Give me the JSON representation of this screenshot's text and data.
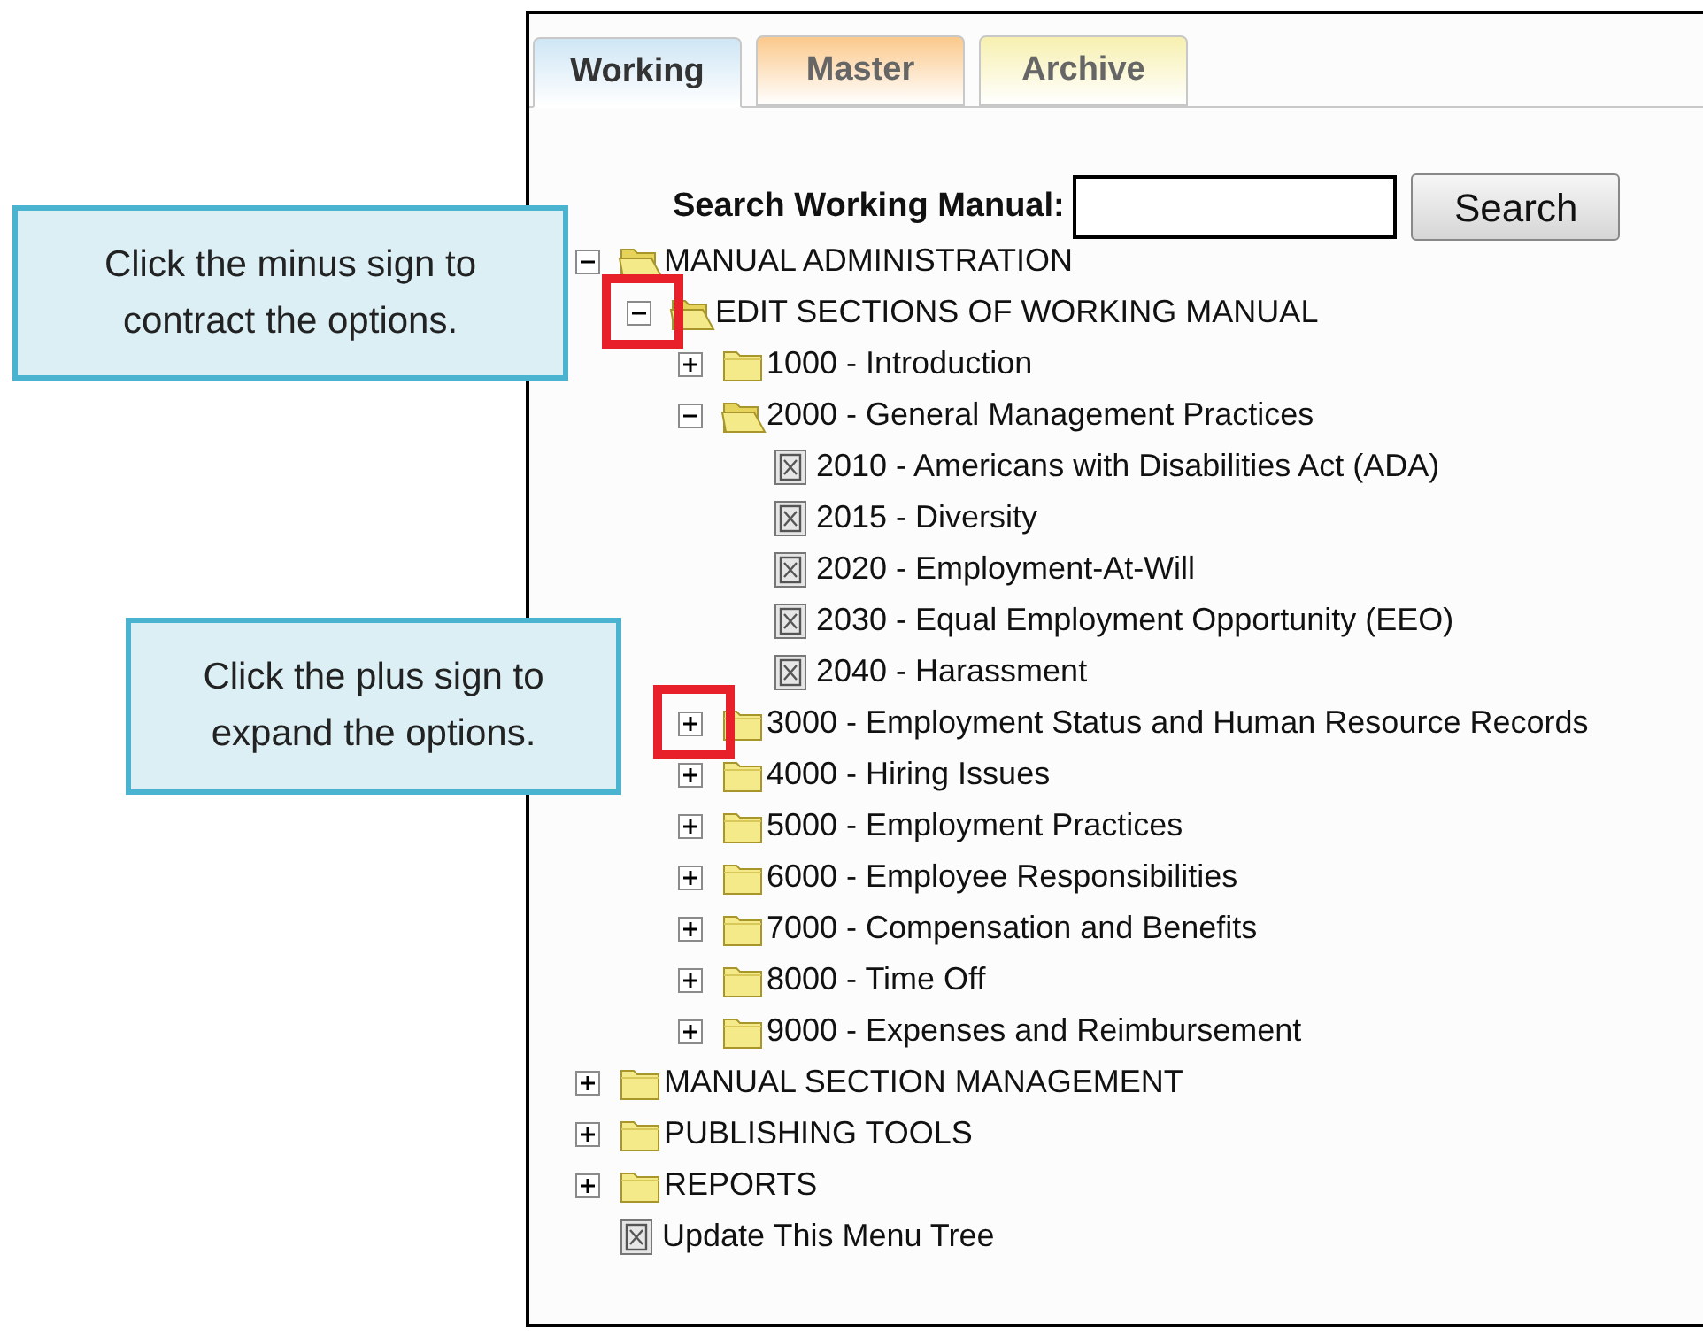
{
  "tabs": [
    {
      "label": "Working",
      "selected": true,
      "color": "#cfe6f5"
    },
    {
      "label": "Master",
      "selected": false,
      "color": "#fbc98c"
    },
    {
      "label": "Archive",
      "selected": false,
      "color": "#f7f0b0"
    }
  ],
  "search": {
    "label": "Search Working Manual:",
    "button": "Search"
  },
  "tree": [
    {
      "kind": "folder",
      "label": "MANUAL ADMINISTRATION",
      "expanded": true,
      "highlighted": false,
      "children": [
        {
          "kind": "folder",
          "label": "EDIT SECTIONS OF WORKING MANUAL",
          "expanded": true,
          "highlighted": true,
          "children": [
            {
              "kind": "folder",
              "label": "1000 - Introduction",
              "expanded": false,
              "highlighted": false
            },
            {
              "kind": "folder",
              "label": "2000 - General Management Practices",
              "expanded": true,
              "highlighted": false,
              "children": [
                {
                  "kind": "page",
                  "label": "2010 - Americans with Disabilities Act (ADA)"
                },
                {
                  "kind": "page",
                  "label": "2015 - Diversity"
                },
                {
                  "kind": "page",
                  "label": "2020 - Employment-At-Will"
                },
                {
                  "kind": "page",
                  "label": "2030 - Equal Employment Opportunity (EEO)"
                },
                {
                  "kind": "page",
                  "label": "2040 - Harassment"
                }
              ]
            },
            {
              "kind": "folder",
              "label": "3000 - Employment Status and Human Resource Records",
              "expanded": false,
              "highlighted": true
            },
            {
              "kind": "folder",
              "label": "4000 - Hiring Issues",
              "expanded": false,
              "highlighted": false
            },
            {
              "kind": "folder",
              "label": "5000 - Employment Practices",
              "expanded": false,
              "highlighted": false
            },
            {
              "kind": "folder",
              "label": "6000 - Employee Responsibilities",
              "expanded": false,
              "highlighted": false
            },
            {
              "kind": "folder",
              "label": "7000 - Compensation and Benefits",
              "expanded": false,
              "highlighted": false
            },
            {
              "kind": "folder",
              "label": "8000 - Time Off",
              "expanded": false,
              "highlighted": false
            },
            {
              "kind": "folder",
              "label": "9000 - Expenses and Reimbursement",
              "expanded": false,
              "highlighted": false
            }
          ]
        }
      ]
    },
    {
      "kind": "folder",
      "label": "MANUAL SECTION MANAGEMENT",
      "expanded": false,
      "highlighted": false
    },
    {
      "kind": "folder",
      "label": "PUBLISHING TOOLS",
      "expanded": false,
      "highlighted": false
    },
    {
      "kind": "folder",
      "label": "REPORTS",
      "expanded": false,
      "highlighted": false
    },
    {
      "kind": "page",
      "label": "Update This Menu Tree"
    }
  ],
  "callouts": [
    {
      "text": "Click the minus sign to contract the options."
    },
    {
      "text": "Click the plus sign to expand the options."
    }
  ]
}
